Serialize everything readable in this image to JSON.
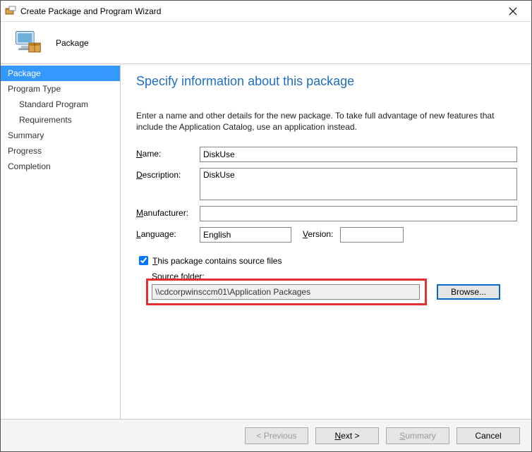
{
  "window": {
    "title": "Create Package and Program Wizard",
    "page_name": "Package"
  },
  "sidebar": {
    "items": [
      {
        "label": "Package",
        "active": true,
        "indent": false
      },
      {
        "label": "Program Type",
        "active": false,
        "indent": false
      },
      {
        "label": "Standard Program",
        "active": false,
        "indent": true
      },
      {
        "label": "Requirements",
        "active": false,
        "indent": true
      },
      {
        "label": "Summary",
        "active": false,
        "indent": false
      },
      {
        "label": "Progress",
        "active": false,
        "indent": false
      },
      {
        "label": "Completion",
        "active": false,
        "indent": false
      }
    ]
  },
  "content": {
    "heading": "Specify information about this package",
    "intro": "Enter a name and other details for the new package. To take full advantage of new features that include the Application Catalog, use an application instead.",
    "labels": {
      "name": "Name:",
      "description": "Description:",
      "manufacturer": "Manufacturer:",
      "language": "Language:",
      "version": "Version:",
      "checkbox": "This package contains source files",
      "source_folder": "Source folder:",
      "browse": "Browse..."
    },
    "values": {
      "name": "DiskUse",
      "description": "DiskUse",
      "manufacturer": "",
      "language": "English",
      "version": "",
      "checked": true,
      "source_folder": "\\\\cdcorpwinsccm01\\Application Packages"
    }
  },
  "footer": {
    "previous": "< Previous",
    "next": "Next >",
    "summary": "Summary",
    "cancel": "Cancel"
  }
}
